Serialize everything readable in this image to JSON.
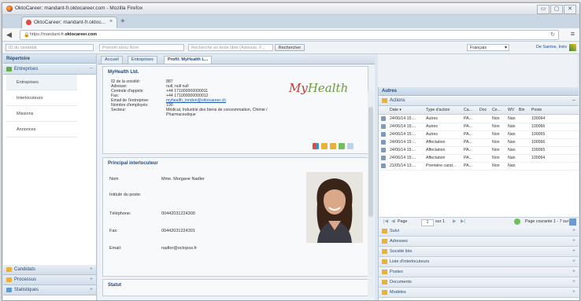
{
  "browser": {
    "window_title": "OktoCareer: mandant-fr.oktocareer.com - Mozilla Firefox",
    "tab_label": "OktoCareer: mandant-fr.oktoc...",
    "url_prefix": "https://mandant-fr.",
    "url_domain": "oktocareer.com",
    "win_min": "▭",
    "win_max": "▢",
    "win_close": "✕"
  },
  "toolbar": {
    "candidate_id_placeholder": "ID du candidat",
    "name_placeholder": "Prénom et/ou Nom",
    "fulltext_placeholder": "Recherche en texte libre (Adresse, F...",
    "search_label": "Rechercher",
    "language": "Français",
    "user": "De Santos, Inès"
  },
  "left": {
    "header": "Répertoire",
    "section_entreprises": "Entreprises",
    "items": [
      "Entreprises",
      "Interlocuteurs",
      "Missions",
      "Annonces"
    ],
    "section_candidats": "Candidats",
    "section_processus": "Processus",
    "section_statistiques": "Statistiques"
  },
  "breadcrumbs": [
    "Accueil",
    "Entreprises",
    "Profil: MyHealth L..."
  ],
  "company": {
    "title": "MyHealth Ltd.",
    "fields": [
      {
        "k": "ID de la société:",
        "v": "887"
      },
      {
        "k": "Adresse:",
        "v": "null, null null"
      },
      {
        "k": "Centrale d'appels:",
        "v": "+44 171000000000011"
      },
      {
        "k": "Fax:",
        "v": "+44 171000000000012"
      },
      {
        "k": "Email de l'entreprise:",
        "v": "myhealth_london@oktocareer.ch",
        "link": true
      },
      {
        "k": "Nombre d'employés:",
        "v": "190"
      },
      {
        "k": "Secteur:",
        "v": "Médical, Industrie des biens de consommation, Chimie / Pharmaceutique"
      }
    ],
    "logo_a": "My",
    "logo_b": "Health"
  },
  "contact": {
    "title": "Principal interlocuteur",
    "rows": [
      {
        "k": "Nom",
        "v": "Mme. Morgane Nadler"
      },
      {
        "k": "Intitulé du poste:",
        "v": ""
      },
      {
        "k": "Téléphone:",
        "v": "00442031224300"
      },
      {
        "k": "Fax:",
        "v": "00442031224301"
      },
      {
        "k": "Email:",
        "v": "nadler@octopos.fr"
      }
    ]
  },
  "statut": {
    "title": "Statut"
  },
  "right": {
    "header": "Autres",
    "actions_label": "Actions",
    "columns": [
      "Date ▾",
      "Type d'action",
      "Ca...",
      "Doc",
      "Ce...",
      "WV",
      "Bin",
      "Poste"
    ],
    "rows": [
      [
        "24/06/14 15:...",
        "Autres",
        "PA...",
        "",
        "Non",
        "Nan",
        "",
        "100064"
      ],
      [
        "24/06/14 15:...",
        "Autres",
        "PA...",
        "",
        "Non",
        "Nan",
        "",
        "100066"
      ],
      [
        "24/06/14 15:...",
        "Autres",
        "PA...",
        "",
        "Non",
        "Nan",
        "",
        "100065"
      ],
      [
        "24/06/14 15:...",
        "Affectation",
        "PA...",
        "",
        "Non",
        "Nan",
        "",
        "100066"
      ],
      [
        "24/06/14 15:...",
        "Affectation",
        "PA...",
        "",
        "Non",
        "Nan",
        "",
        "100065"
      ],
      [
        "24/06/14 15:...",
        "Affectation",
        "PA...",
        "",
        "Non",
        "Nan",
        "",
        "100064"
      ],
      [
        "21/05/14 13:...",
        "Première cand...",
        "PA...",
        "",
        "Non",
        "Nan",
        "",
        ""
      ]
    ],
    "pager": {
      "page_label": "Page",
      "page_value": "1",
      "of": "sur 1",
      "info": "Page courante 1 - 7 sur 7"
    },
    "sections": [
      "Suivi",
      "Adresses",
      "Société liée",
      "Liste d'interlocuteurs",
      "Postes",
      "Documents",
      "Modèles"
    ]
  }
}
